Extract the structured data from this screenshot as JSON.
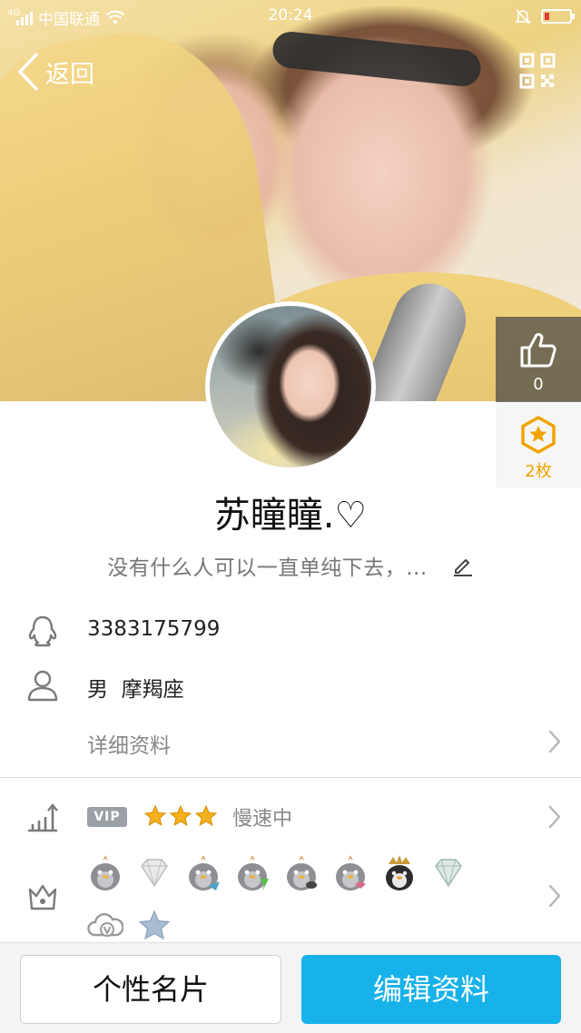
{
  "status_bar": {
    "network": "4G",
    "carrier": "中国联通",
    "time": "20:24"
  },
  "nav": {
    "back_label": "返回"
  },
  "side_panel": {
    "like_count": "0",
    "gift_count": "2枚"
  },
  "profile": {
    "name": "苏瞳瞳.♡",
    "signature": "没有什么人可以一直单纯下去，..."
  },
  "info": {
    "qq_number": "3383175799",
    "gender_zodiac": "男  摩羯座",
    "details_label": "详细资料"
  },
  "vip": {
    "badge": "VIP",
    "stars": 3,
    "status": "慢速中"
  },
  "badges": [
    "crown-penguin-icon",
    "diamond-icon",
    "crown-penguin-blue-icon",
    "crown-penguin-green-icon",
    "crown-penguin-mustache-icon",
    "crown-penguin-bowtie-icon",
    "king-penguin-icon",
    "green-diamond-icon",
    "cloud-v-icon",
    "blue-star-icon"
  ],
  "bottom_bar": {
    "card_label": "个性名片",
    "edit_label": "编辑资料"
  },
  "colors": {
    "accent": "#17b2ea",
    "gift": "#f0a400",
    "vip_star": "#f2b01e"
  }
}
